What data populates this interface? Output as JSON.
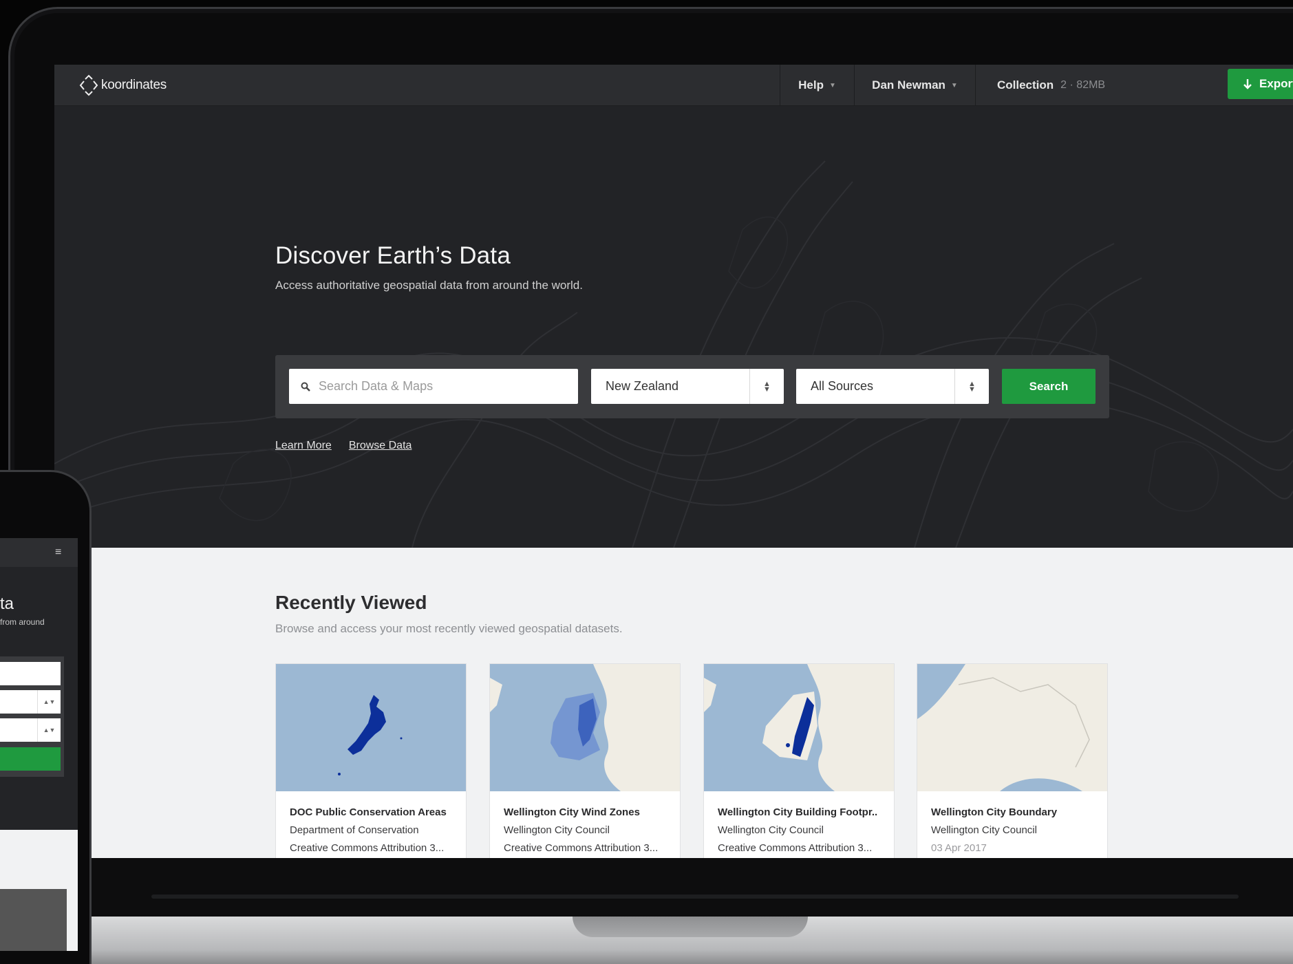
{
  "app": {
    "logo_text": "koordinates"
  },
  "nav": {
    "help_label": "Help",
    "user_label": "Dan Newman",
    "collection_label": "Collection",
    "collection_meta": "2 · 82MB",
    "export_label": "Export"
  },
  "hero": {
    "title": "Discover Earth’s Data",
    "subtitle": "Access authoritative geospatial data from around the world.",
    "search_placeholder": "Search Data & Maps",
    "country_selected": "New Zealand",
    "source_selected": "All Sources",
    "search_button": "Search",
    "links": [
      "Learn More",
      "Browse Data"
    ]
  },
  "recent": {
    "title": "Recently Viewed",
    "subtitle": "Browse and access your most recently viewed geospatial datasets.",
    "cards": [
      {
        "title": "DOC Public Conservation Areas",
        "publisher": "Department of Conservation",
        "meta": "Creative Commons Attribution 3..."
      },
      {
        "title": "Wellington City Wind Zones",
        "publisher": "Wellington City Council",
        "meta": "Creative Commons Attribution 3..."
      },
      {
        "title": "Wellington City Building Footpr..",
        "publisher": "Wellington City Council",
        "meta": "Creative Commons Attribution 3..."
      },
      {
        "title": "Wellington City Boundary",
        "publisher": "Wellington City Council",
        "meta": "03 Apr 2017"
      }
    ]
  },
  "phone": {
    "title_fragment": "ta",
    "subtitle_fragment": "from around"
  },
  "colors": {
    "accent_green": "#1f9a3f",
    "nav_bg": "#2c2d30",
    "hero_bg": "#222326",
    "section_bg": "#f1f2f3",
    "map_water": "#9cb8d3",
    "map_land": "#f0ede4",
    "map_feature": "#0c2f9a"
  },
  "icons": {
    "logo": "koordinates-diamond-logo",
    "search": "search-icon",
    "export": "download-arrow-icon",
    "select": "updown-chevron-icon",
    "menu": "hamburger-menu-icon"
  }
}
